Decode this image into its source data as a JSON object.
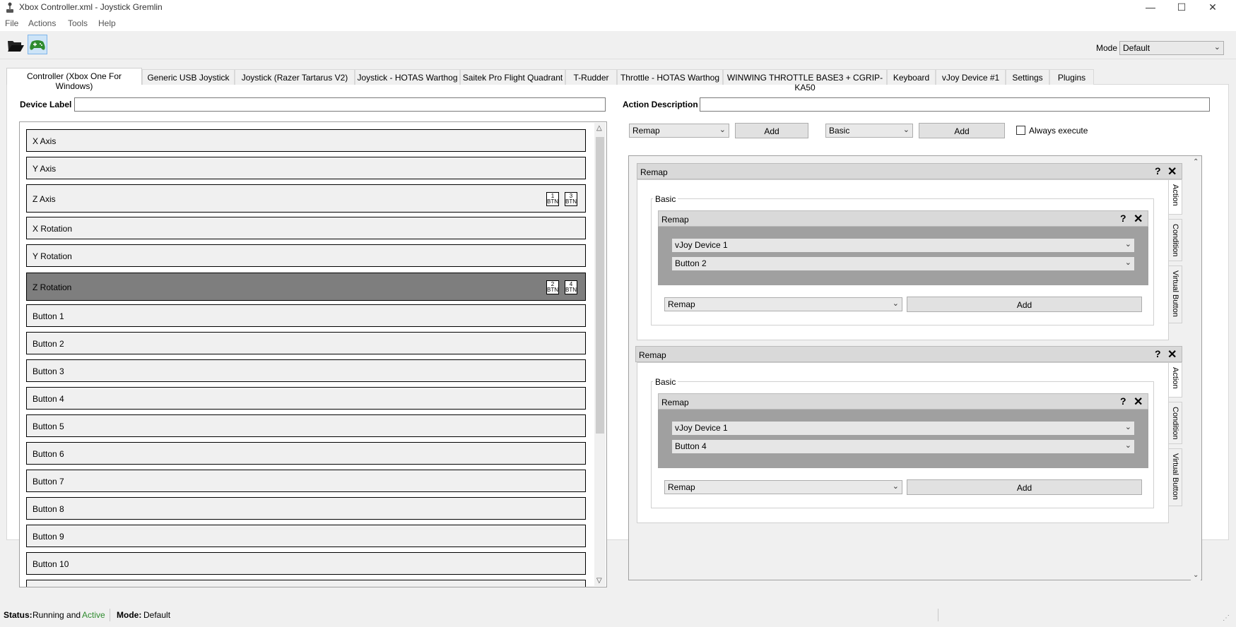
{
  "window": {
    "title": "Xbox Controller.xml - Joystick Gremlin",
    "minimize": "—",
    "maximize": "☐",
    "close": "✕"
  },
  "menu": [
    "File",
    "Actions",
    "Tools",
    "Help"
  ],
  "toolbar": {
    "open_icon": "folder-open-icon",
    "gamepad_icon": "gamepad-icon",
    "mode_label": "Mode",
    "mode_value": "Default"
  },
  "tabs": [
    "Controller (Xbox One For Windows)",
    "Generic   USB  Joystick",
    "Joystick (Razer Tartarus V2)",
    "Joystick - HOTAS Warthog",
    "Saitek Pro Flight Quadrant",
    "T-Rudder",
    "Throttle - HOTAS Warthog",
    "WINWING THROTTLE BASE3 + CGRIP-KA50",
    "Keyboard",
    "vJoy Device #1",
    "Settings",
    "Plugins"
  ],
  "device_label": {
    "label": "Device Label",
    "value": ""
  },
  "action_description": {
    "label": "Action Description",
    "value": ""
  },
  "inputs": [
    {
      "label": "X Axis",
      "badges": []
    },
    {
      "label": "Y Axis",
      "badges": []
    },
    {
      "label": "Z Axis",
      "badges": [
        {
          "n": "1",
          "t": "BTN"
        },
        {
          "n": "3",
          "t": "BTN"
        }
      ]
    },
    {
      "label": "X Rotation",
      "badges": []
    },
    {
      "label": "Y Rotation",
      "badges": []
    },
    {
      "label": "Z Rotation",
      "badges": [
        {
          "n": "2",
          "t": "BTN"
        },
        {
          "n": "4",
          "t": "BTN"
        }
      ],
      "selected": true
    },
    {
      "label": "Button 1",
      "badges": []
    },
    {
      "label": "Button 2",
      "badges": []
    },
    {
      "label": "Button 3",
      "badges": []
    },
    {
      "label": "Button 4",
      "badges": []
    },
    {
      "label": "Button 5",
      "badges": []
    },
    {
      "label": "Button 6",
      "badges": []
    },
    {
      "label": "Button 7",
      "badges": []
    },
    {
      "label": "Button 8",
      "badges": []
    },
    {
      "label": "Button 9",
      "badges": []
    },
    {
      "label": "Button 10",
      "badges": []
    }
  ],
  "action_bar": {
    "action_type": "Remap",
    "add1": "Add",
    "container_type": "Basic",
    "add2": "Add",
    "always_execute": "Always execute"
  },
  "containers": [
    {
      "title": "Remap",
      "help": "?",
      "close": "✕",
      "group": "Basic",
      "inner_title": "Remap",
      "device": "vJoy Device 1",
      "button": "Button 2",
      "add_type": "Remap",
      "add": "Add",
      "vtabs": [
        "Action",
        "Condition",
        "Virtual Button"
      ]
    },
    {
      "title": "Remap",
      "help": "?",
      "close": "✕",
      "group": "Basic",
      "inner_title": "Remap",
      "device": "vJoy Device 1",
      "button": "Button 4",
      "add_type": "Remap",
      "add": "Add",
      "vtabs": [
        "Action",
        "Condition",
        "Virtual Button"
      ]
    }
  ],
  "status": {
    "status_label": "Status:",
    "status_text": "Running and",
    "status_active": "Active",
    "mode_label": "Mode:",
    "mode_value": "Default"
  },
  "colors": {
    "active_green": "#2e8b2e",
    "selected_row": "#7e7e7e"
  }
}
